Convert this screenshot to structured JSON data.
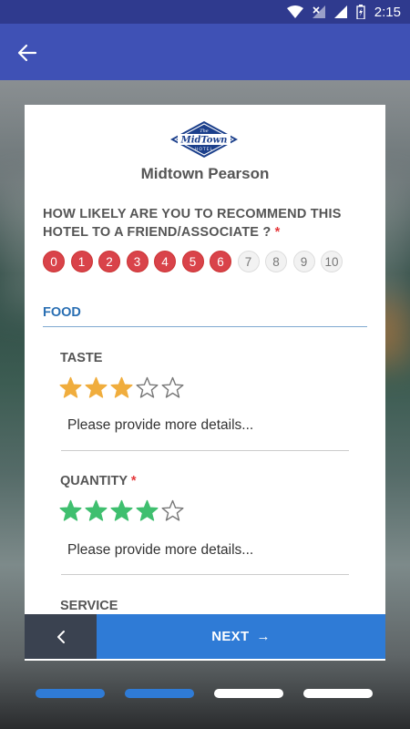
{
  "status_bar": {
    "time": "2:15"
  },
  "hotel": {
    "logo_text": "MidTown",
    "logo_sub": "HOTEL",
    "logo_top": "The",
    "name": "Midtown Pearson"
  },
  "question": {
    "text": "HOW LIKELY ARE YOU TO RECOMMEND THIS HOTEL TO A FRIEND/ASSOCIATE ?",
    "required_mark": "*",
    "scale": [
      "0",
      "1",
      "2",
      "3",
      "4",
      "5",
      "6",
      "7",
      "8",
      "9",
      "10"
    ],
    "selected": 6
  },
  "section": {
    "title": "FOOD"
  },
  "fields": [
    {
      "label": "TASTE",
      "required": false,
      "rating": 3,
      "max": 5,
      "star_color": "#f0ad3d",
      "placeholder": "Please provide more details..."
    },
    {
      "label": "QUANTITY",
      "required": true,
      "required_mark": "*",
      "rating": 4,
      "max": 5,
      "star_color": "#3fbf6f",
      "placeholder": "Please provide more details..."
    },
    {
      "label": "SERVICE",
      "required": false
    }
  ],
  "nav": {
    "next_label": "NEXT",
    "next_arrow": "→"
  },
  "progress": {
    "steps": 4,
    "completed": 2
  },
  "colors": {
    "appbar": "#3f51b5",
    "statusbar": "#2f3a8e",
    "accent": "#2f7bd6",
    "nps_selected": "#d9434a"
  }
}
